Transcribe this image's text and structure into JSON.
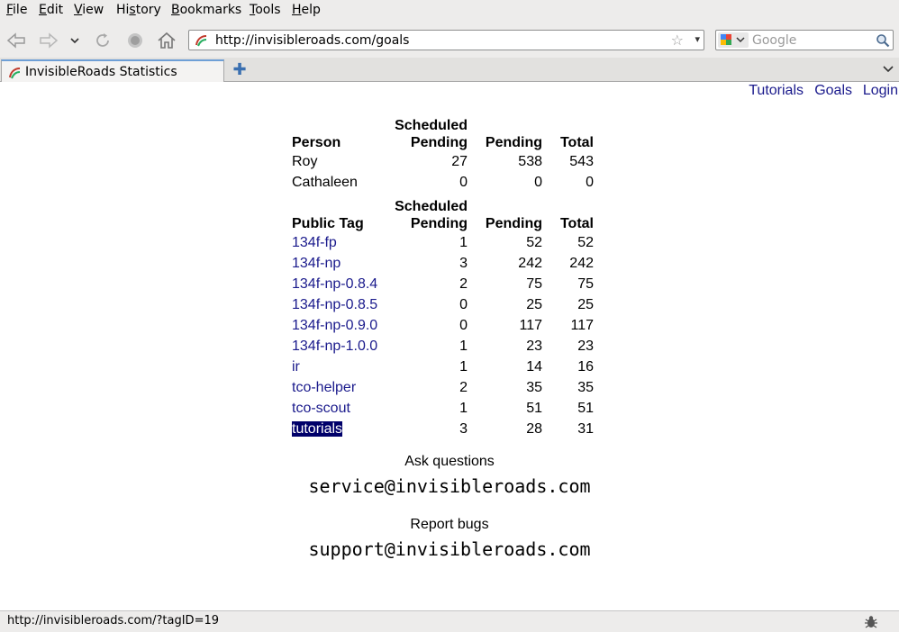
{
  "menubar": {
    "items": [
      {
        "pre": "",
        "u": "F",
        "post": "ile"
      },
      {
        "pre": "",
        "u": "E",
        "post": "dit"
      },
      {
        "pre": "",
        "u": "V",
        "post": "iew"
      },
      {
        "pre": "Hi",
        "u": "s",
        "post": "tory"
      },
      {
        "pre": "",
        "u": "B",
        "post": "ookmarks"
      },
      {
        "pre": "",
        "u": "T",
        "post": "ools"
      },
      {
        "pre": "",
        "u": "H",
        "post": "elp"
      }
    ]
  },
  "toolbar": {
    "url": "http://invisibleroads.com/goals",
    "search_placeholder": "Google"
  },
  "tab": {
    "title": "InvisibleRoads Statistics"
  },
  "toplinks": [
    "Tutorials",
    "Goals",
    "Login"
  ],
  "person_table": {
    "headers": [
      "Person",
      "Scheduled",
      "Pending",
      "Pending",
      "Total"
    ],
    "rows": [
      {
        "name": "Roy",
        "scheduled": "27",
        "pending": "538",
        "total": "543"
      },
      {
        "name": "Cathaleen",
        "scheduled": "0",
        "pending": "0",
        "total": "0"
      }
    ]
  },
  "tag_table": {
    "headers": [
      "Public Tag",
      "Scheduled",
      "Pending",
      "Pending",
      "Total"
    ],
    "rows": [
      {
        "name": "134f-fp",
        "scheduled": "1",
        "pending": "52",
        "total": "52"
      },
      {
        "name": "134f-np",
        "scheduled": "3",
        "pending": "242",
        "total": "242"
      },
      {
        "name": "134f-np-0.8.4",
        "scheduled": "2",
        "pending": "75",
        "total": "75"
      },
      {
        "name": "134f-np-0.8.5",
        "scheduled": "0",
        "pending": "25",
        "total": "25"
      },
      {
        "name": "134f-np-0.9.0",
        "scheduled": "0",
        "pending": "117",
        "total": "117"
      },
      {
        "name": "134f-np-1.0.0",
        "scheduled": "1",
        "pending": "23",
        "total": "23"
      },
      {
        "name": "ir",
        "scheduled": "1",
        "pending": "14",
        "total": "16"
      },
      {
        "name": "tco-helper",
        "scheduled": "2",
        "pending": "35",
        "total": "35"
      },
      {
        "name": "tco-scout",
        "scheduled": "1",
        "pending": "51",
        "total": "51"
      },
      {
        "name": "tutorials",
        "scheduled": "3",
        "pending": "28",
        "total": "31",
        "selected": true
      }
    ]
  },
  "contact": {
    "ask_label": "Ask questions",
    "ask_email": "service@invisibleroads.com",
    "bug_label": "Report bugs",
    "bug_email": "support@invisibleroads.com"
  },
  "statusbar": {
    "text": "http://invisibleroads.com/?tagID=19"
  },
  "colors": {
    "link": "#1a1a8c",
    "selected_bg": "#00006a",
    "chrome": "#edeceb"
  }
}
